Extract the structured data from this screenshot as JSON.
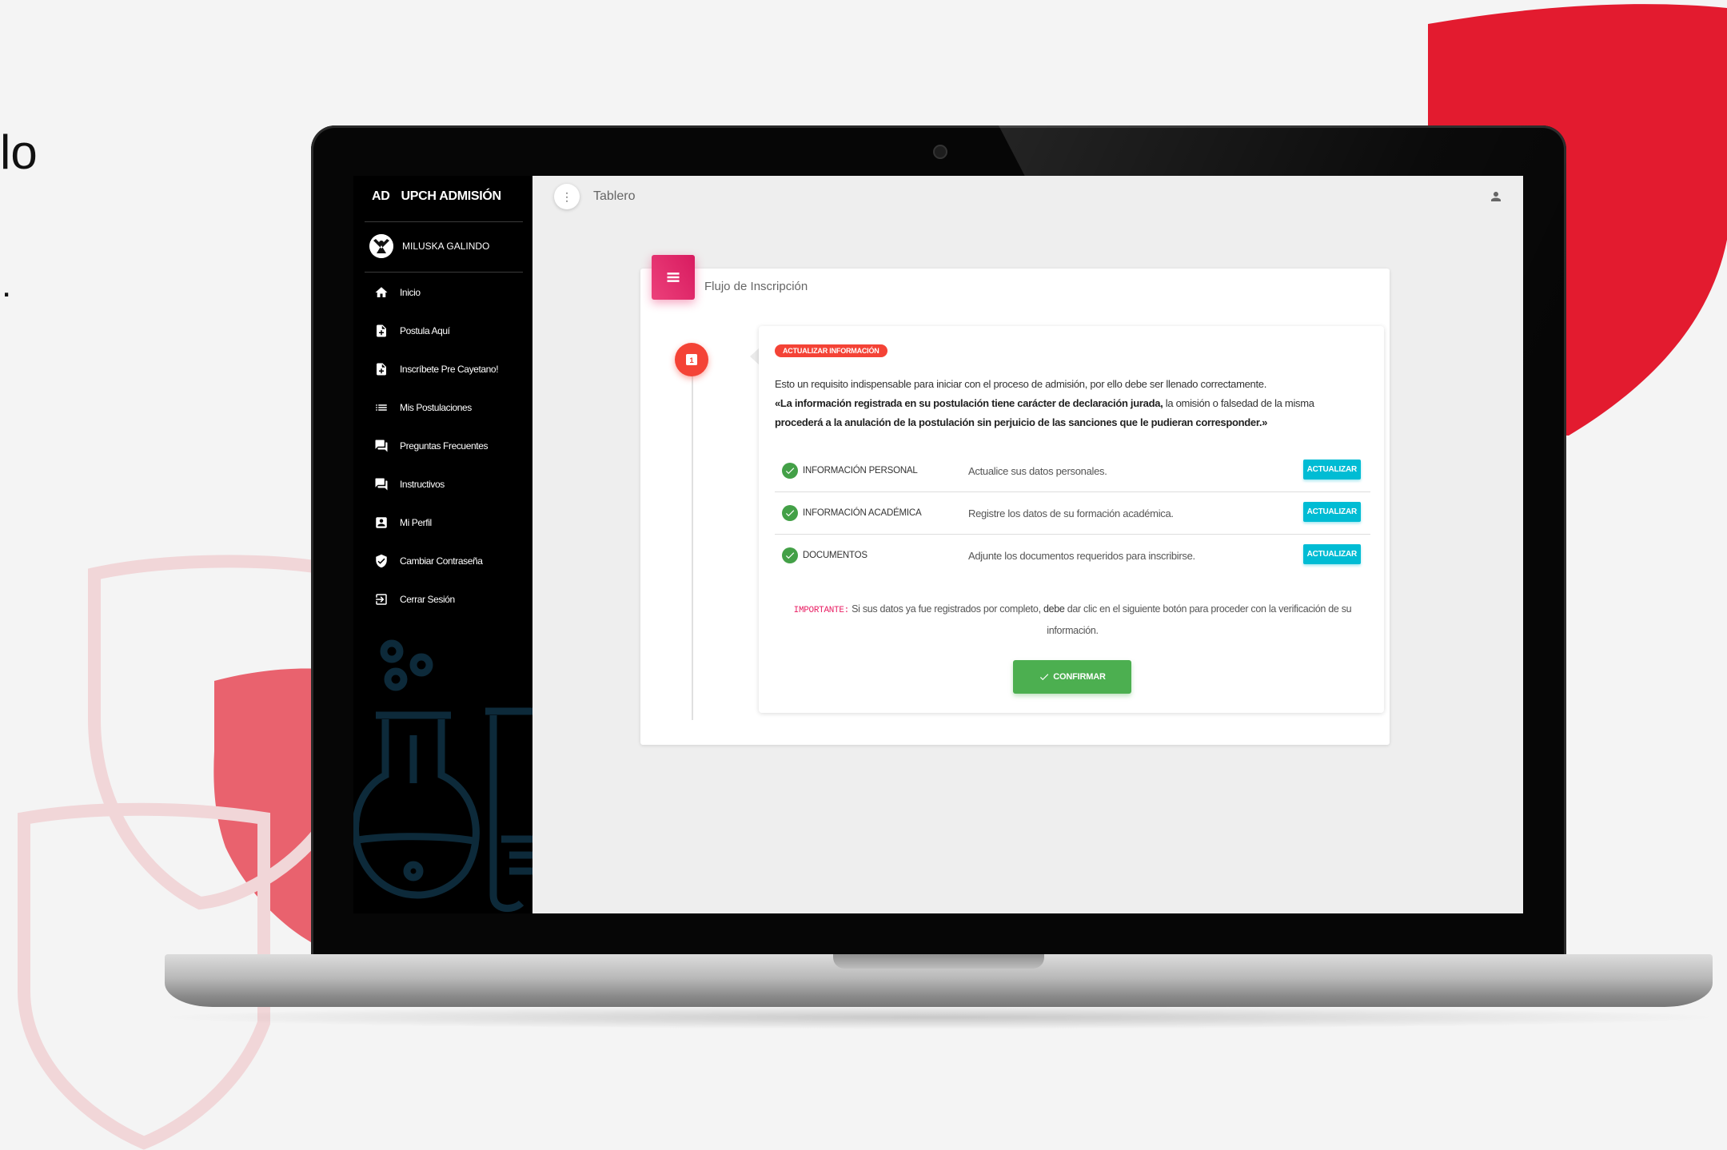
{
  "background": {
    "fragment_1": "lo",
    "fragment_2": "."
  },
  "app": {
    "brand_short": "AD",
    "brand_name": "UPCH ADMISIÓN",
    "user_name": "MILUSKA GALINDO"
  },
  "sidebar": {
    "items": [
      {
        "label": "Inicio",
        "icon": "home-icon"
      },
      {
        "label": "Postula Aquí",
        "icon": "file-add-icon"
      },
      {
        "label": "Inscríbete Pre Cayetano!",
        "icon": "file-add-icon"
      },
      {
        "label": "Mis Postulaciones",
        "icon": "list-icon"
      },
      {
        "label": "Preguntas Frecuentes",
        "icon": "forum-icon"
      },
      {
        "label": "Instructivos",
        "icon": "forum-icon"
      },
      {
        "label": "Mi Perfil",
        "icon": "account-box-icon"
      },
      {
        "label": "Cambiar Contraseña",
        "icon": "shield-check-icon"
      },
      {
        "label": "Cerrar Sesión",
        "icon": "exit-icon"
      }
    ]
  },
  "topbar": {
    "title": "Tablero"
  },
  "card": {
    "title": "Flujo de Inscripción",
    "step_number": "1",
    "tag": "ACTUALIZAR INFORMACIÓN",
    "intro_line_1": "Esto un requisito indispensable para iniciar con el proceso de admisión, por ello debe ser llenado correctamente.",
    "intro_quote_bold_1": "«La información registrada en su postulación tiene carácter de declaración jurada,",
    "intro_quote_mid": " la omisión o falsedad de la misma",
    "intro_quote_bold_2": "procederá a la anulación de la postulación sin perjuicio de las sanciones que le pudieran corresponder.»",
    "requirements": [
      {
        "name": "INFORMACIÓN PERSONAL",
        "description": "Actualice sus datos personales.",
        "button": "ACTUALIZAR"
      },
      {
        "name": "INFORMACIÓN ACADÉMICA",
        "description": "Registre los datos de su formación académica.",
        "button": "ACTUALIZAR"
      },
      {
        "name": "DOCUMENTOS",
        "description": "Adjunte los documentos requeridos para inscribirse.",
        "button": "ACTUALIZAR"
      }
    ],
    "note_label": "IMPORTANTE:",
    "note_text_1": " Si sus datos ya fue registrados por completo, ",
    "note_bold": "debe",
    "note_text_2": " dar clic en el siguiente botón para proceder con la verificación de su información.",
    "confirm_button": "CONFIRMAR"
  },
  "colors": {
    "brand_red": "#e31b2f",
    "sidebar_bg": "#000000",
    "card_icon": "#e91e63",
    "tag_red": "#f44336",
    "update_button": "#00bcd4",
    "confirm_button": "#4caf50"
  }
}
